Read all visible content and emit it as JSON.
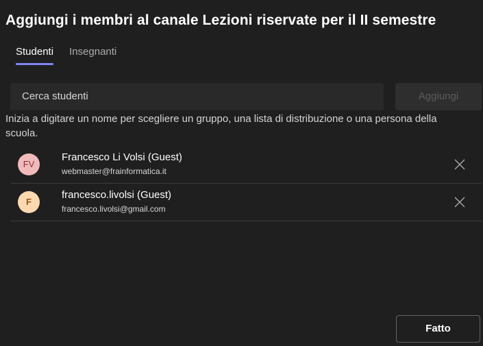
{
  "dialog": {
    "title": "Aggiungi i membri al canale Lezioni riservate per il II semestre"
  },
  "tabs": [
    {
      "label": "Studenti",
      "active": true
    },
    {
      "label": "Insegnanti",
      "active": false
    }
  ],
  "search": {
    "placeholder": "Cerca studenti",
    "value": ""
  },
  "add_button": {
    "label": "Aggiungi",
    "enabled": false
  },
  "hint": "Inizia a digitare un nome per scegliere un gruppo, una lista di distribuzione o una persona della scuola.",
  "members": [
    {
      "initials": "FV",
      "name": "Francesco Li Volsi (Guest)",
      "email": "webmaster@frainformatica.it",
      "avatar_color": "#f1bbbc",
      "remove_icon": "close-icon"
    },
    {
      "initials": "F",
      "name": "francesco.livolsi (Guest)",
      "email": "francesco.livolsi@gmail.com",
      "avatar_color": "#fcd9b0",
      "remove_icon": "close-icon"
    }
  ],
  "done_button": {
    "label": "Fatto"
  },
  "colors": {
    "background": "#1f1f1f",
    "tab_indicator": "#7f85f5",
    "input_bg": "#292929",
    "divider": "#3d3d3d"
  }
}
